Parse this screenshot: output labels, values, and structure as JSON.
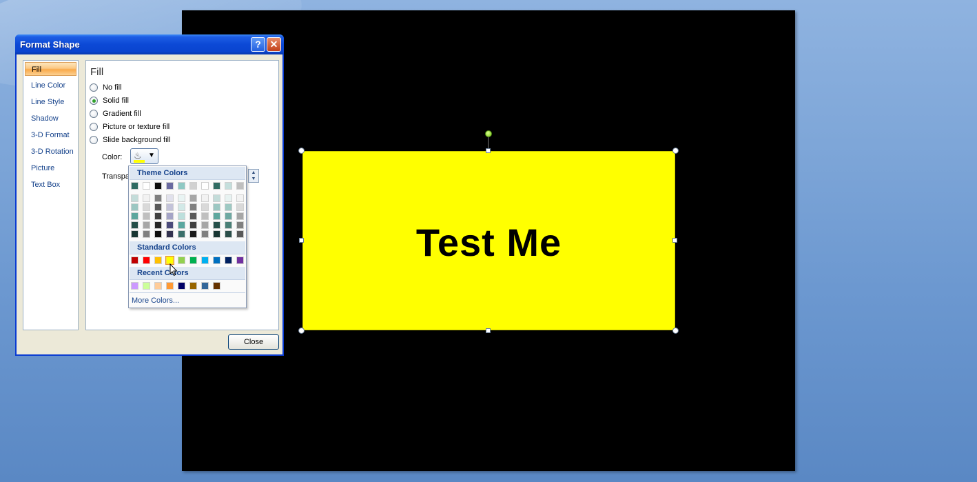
{
  "dialog": {
    "title": "Format Shape",
    "help_label": "?",
    "close_label": "✕",
    "close_button": "Close"
  },
  "nav": {
    "items": [
      "Fill",
      "Line Color",
      "Line Style",
      "Shadow",
      "3-D Format",
      "3-D Rotation",
      "Picture",
      "Text Box"
    ],
    "selected": "Fill"
  },
  "fill_panel": {
    "title": "Fill",
    "options": [
      "No fill",
      "Solid fill",
      "Gradient fill",
      "Picture or texture fill",
      "Slide background fill"
    ],
    "selected": "Solid fill",
    "color_label": "Color:",
    "transparency_label": "Transpa"
  },
  "color_popup": {
    "theme_header": "Theme Colors",
    "standard_header": "Standard Colors",
    "recent_header": "Recent Colors",
    "more_colors": "More Colors...",
    "theme_top": [
      "#2f6b62",
      "#ffffff",
      "#0d0d0d",
      "#6a6aa0",
      "#8fc9c4",
      "#d1d1d1",
      "#ffffff",
      "#2f6b62",
      "#c4dedc",
      "#bfbfbf"
    ],
    "theme_shades": [
      [
        "#c3dcd9",
        "#9cc7c2",
        "#5ea79e",
        "#244f49",
        "#173532"
      ],
      [
        "#f2f2f2",
        "#d9d9d9",
        "#bfbfbf",
        "#a6a6a6",
        "#808080"
      ],
      [
        "#808080",
        "#595959",
        "#404040",
        "#262626",
        "#0d0d0d"
      ],
      [
        "#e1e1ec",
        "#c3c3d9",
        "#a4a4c6",
        "#4b4b7b",
        "#32324f"
      ],
      [
        "#e9f4f3",
        "#d2e9e7",
        "#bcdfdc",
        "#5aa79f",
        "#3b6f6a"
      ],
      [
        "#a6a6a6",
        "#808080",
        "#595959",
        "#404040",
        "#1a1a1a"
      ],
      [
        "#f2f2f2",
        "#d9d9d9",
        "#bfbfbf",
        "#a6a6a6",
        "#7f7f7f"
      ],
      [
        "#c3dcd9",
        "#9cc7c2",
        "#5ea79e",
        "#244f49",
        "#173532"
      ],
      [
        "#e7f2f1",
        "#9ec9c3",
        "#6fa9a2",
        "#4a8077",
        "#2a4e49"
      ],
      [
        "#f2f2f2",
        "#d9d9d9",
        "#a6a6a6",
        "#808080",
        "#595959"
      ]
    ],
    "standard": [
      "#c00000",
      "#ff0000",
      "#ffc000",
      "#ffff00",
      "#92d050",
      "#00b050",
      "#00b0f0",
      "#0070c0",
      "#002060",
      "#7030a0"
    ],
    "standard_selected": "#ffff00",
    "recent": [
      "#cc99ff",
      "#ccff99",
      "#ffcc99",
      "#ff9933",
      "#000066",
      "#996600",
      "#336699",
      "#663300"
    ]
  },
  "slide": {
    "shape_text": "Test Me",
    "shape_color": "#ffff00",
    "background": "#000000"
  }
}
